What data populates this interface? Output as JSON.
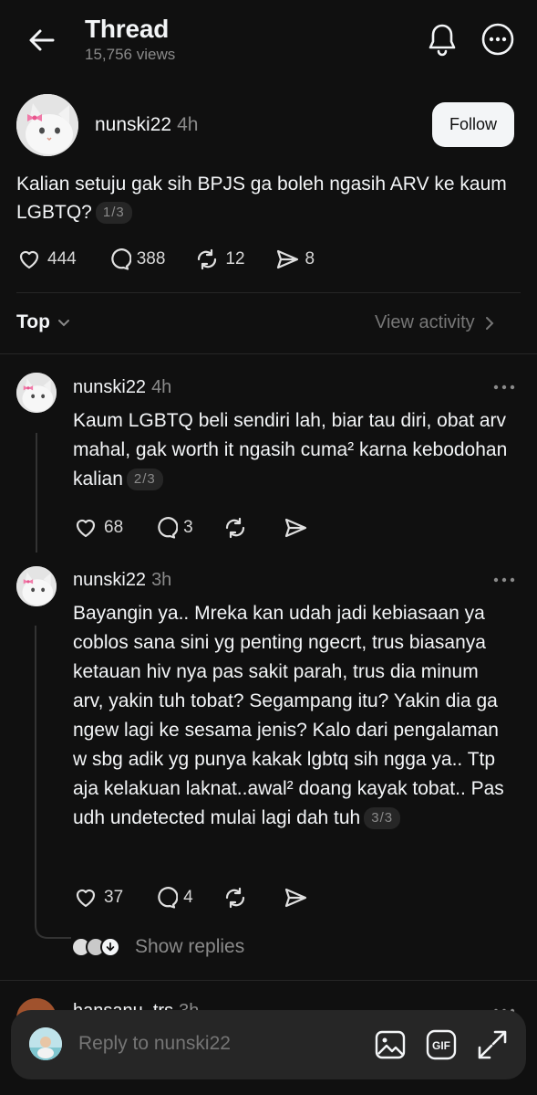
{
  "header": {
    "title": "Thread",
    "views": "15,756 views"
  },
  "post": {
    "username": "nunski22",
    "time": "4h",
    "follow_label": "Follow",
    "text": "Kalian setuju gak sih BPJS ga boleh ngasih ARV ke kaum LGBTQ?",
    "page": "1/3",
    "likes": "444",
    "comments": "388",
    "reposts": "12",
    "shares": "8"
  },
  "sort": {
    "label": "Top",
    "view_activity": "View activity"
  },
  "replies": [
    {
      "username": "nunski22",
      "time": "4h",
      "text": "Kaum LGBTQ beli sendiri lah, biar tau diri, obat arv mahal, gak worth it ngasih cuma² karna kebodohan kalian",
      "page": "2/3",
      "likes": "68",
      "comments": "3"
    },
    {
      "username": "nunski22",
      "time": "3h",
      "text": "Bayangin ya.. Mreka kan udah jadi kebiasaan ya coblos sana sini yg penting ngecrt, trus biasanya ketauan hiv nya pas sakit parah, trus dia minum arv, yakin tuh tobat? Segampang itu? Yakin dia ga ngew lagi ke sesama jenis? Kalo dari pengalaman w sbg adik yg punya kakak lgbtq sih ngga ya.. Ttp aja kelakuan laknat..awal² doang kayak tobat.. Pas udh undetected mulai lagi dah tuh",
      "page": "3/3",
      "likes": "37",
      "comments": "4"
    }
  ],
  "show_replies": "Show replies",
  "next_reply": {
    "username": "hansanu_trs",
    "time": "3h"
  },
  "composer": {
    "placeholder": "Reply to nunski22"
  },
  "colors": {
    "background": "#101010",
    "text": "#f3f5f7",
    "muted": "#8a8a8a",
    "composer": "#262626"
  }
}
